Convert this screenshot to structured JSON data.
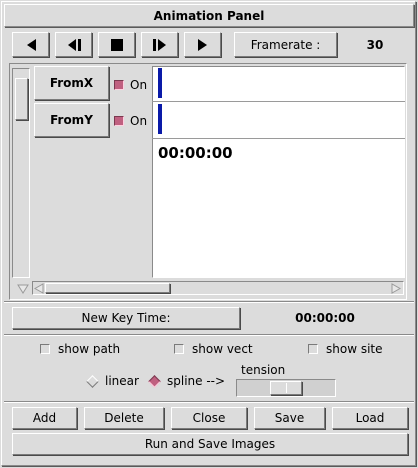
{
  "window": {
    "title": "Animation Panel"
  },
  "transport": {
    "buttons": [
      {
        "name": "rewind",
        "icon": "play-backward-icon"
      },
      {
        "name": "step-back",
        "icon": "step-backward-icon"
      },
      {
        "name": "stop",
        "icon": "stop-icon"
      },
      {
        "name": "step-forward",
        "icon": "step-forward-icon"
      },
      {
        "name": "play",
        "icon": "play-forward-icon"
      }
    ],
    "framerate_label": "Framerate :",
    "framerate_value": "30"
  },
  "tracks": [
    {
      "label": "FromX",
      "on_label": "On",
      "checked": true
    },
    {
      "label": "FromY",
      "on_label": "On",
      "checked": true
    }
  ],
  "timeline": {
    "current_time": "00:00:00"
  },
  "new_key": {
    "label": "New Key Time:",
    "value": "00:00:00"
  },
  "options": {
    "show_path": "show path",
    "show_vect": "show vect",
    "show_site": "show site",
    "linear": "linear",
    "spline": "spline -->",
    "tension": "tension",
    "interpolation_selected": "spline"
  },
  "actions": {
    "add": "Add",
    "delete": "Delete",
    "close": "Close",
    "save": "Save",
    "load": "Load",
    "run": "Run and Save Images"
  },
  "colors": {
    "accent": "#c06080",
    "marker": "#0a1aa8",
    "panel": "#dcdcdc"
  }
}
